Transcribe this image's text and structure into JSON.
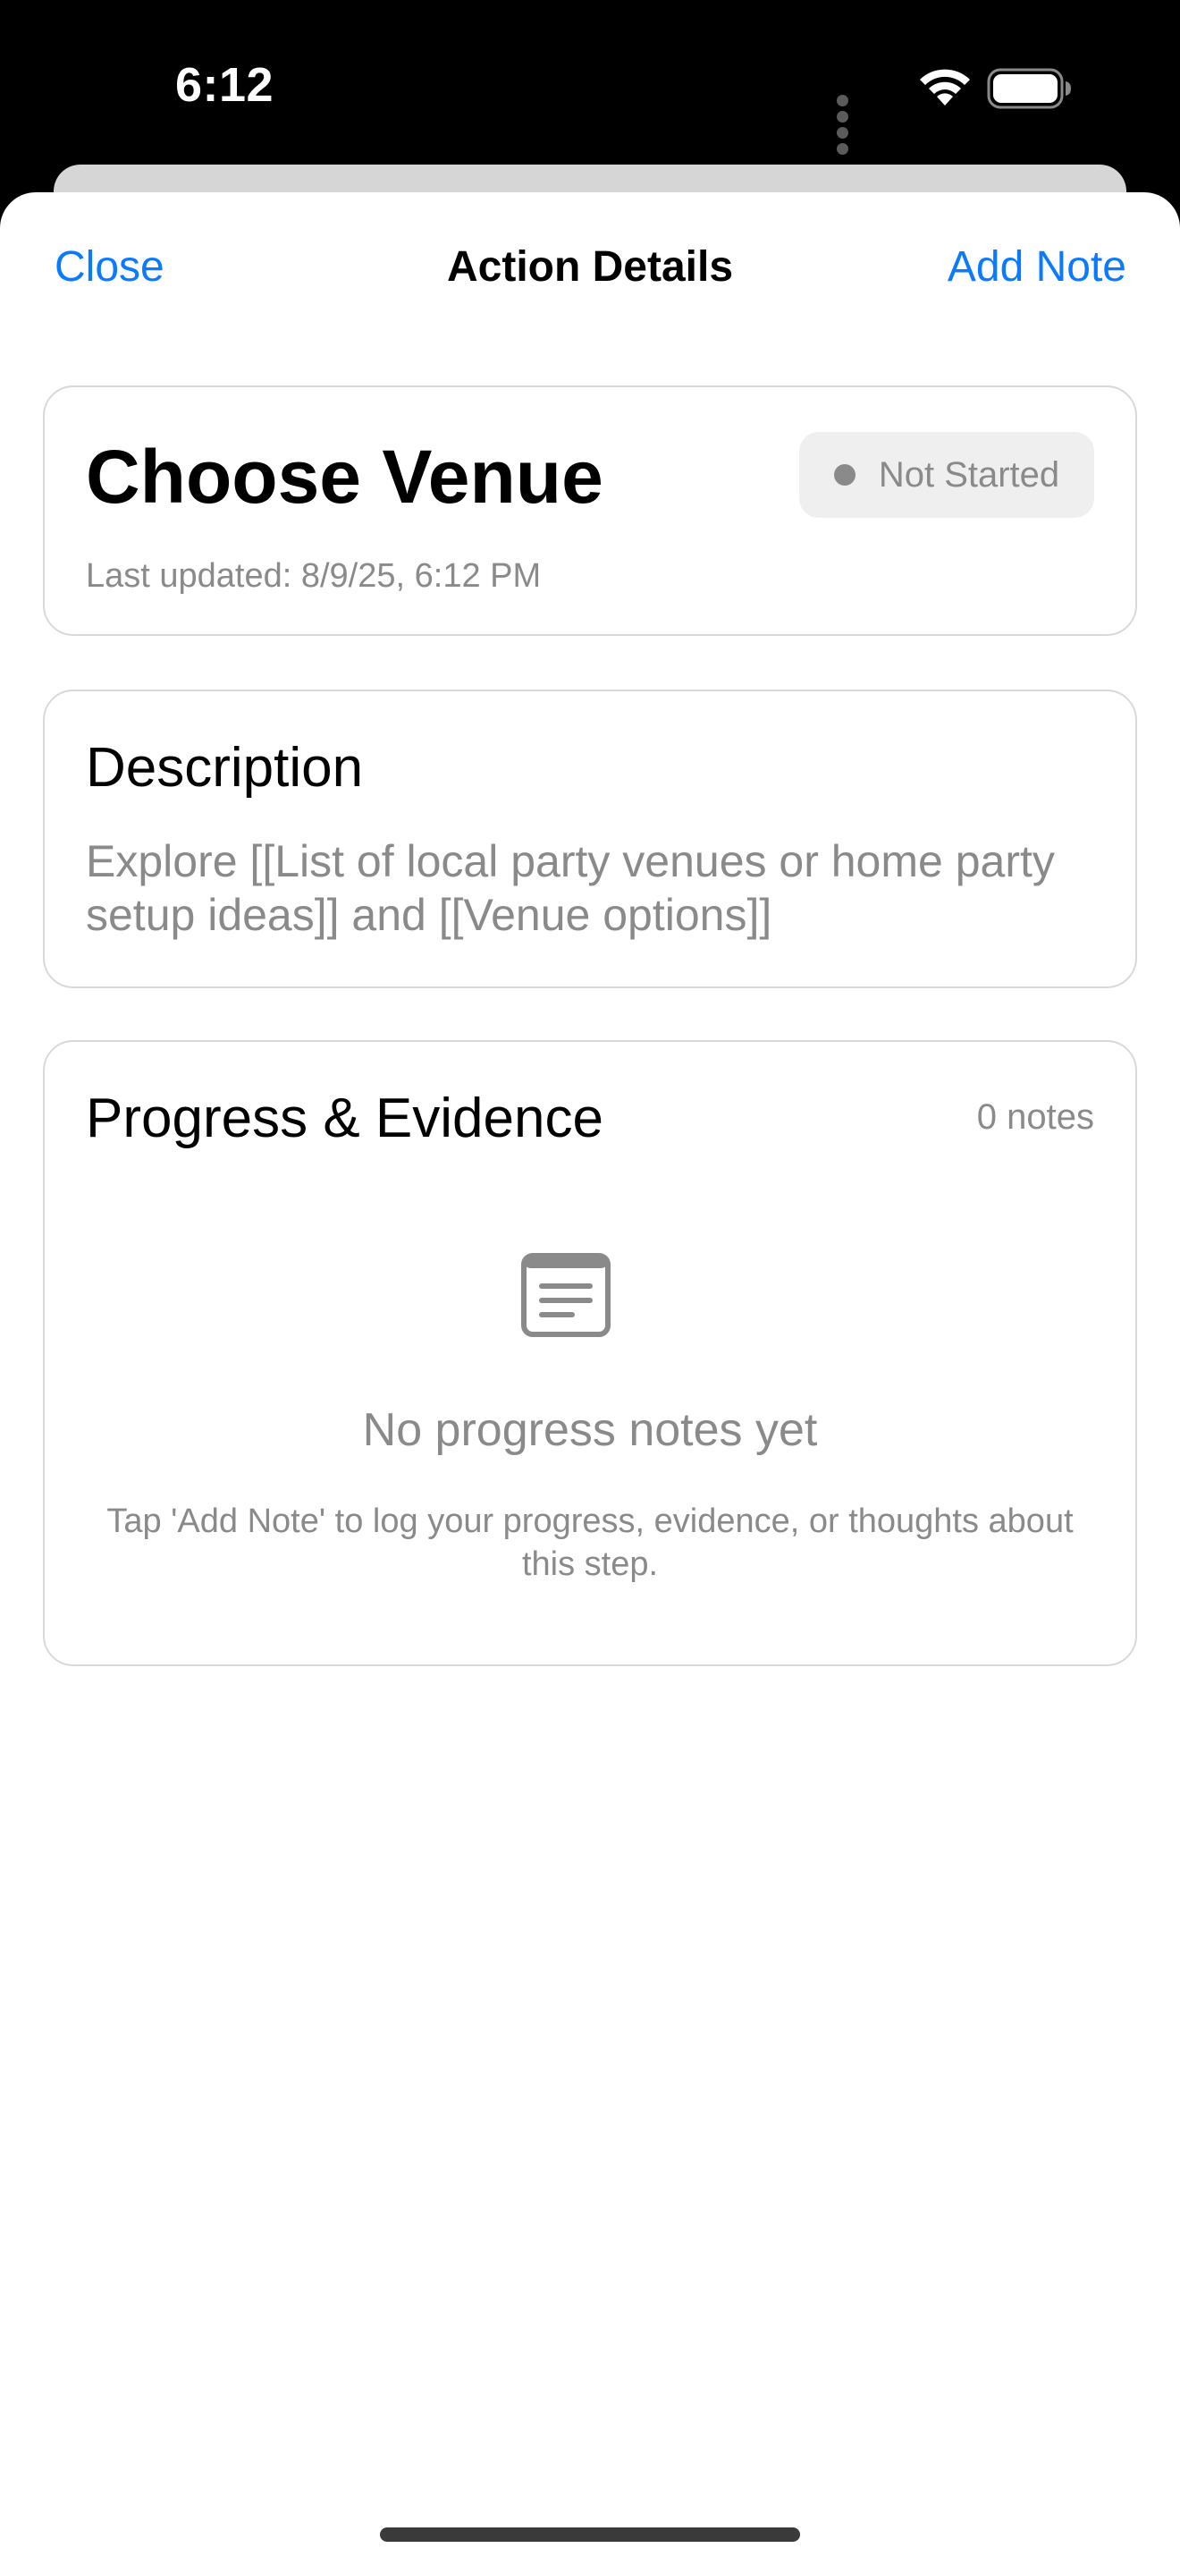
{
  "status_bar": {
    "time": "6:12",
    "icons": [
      "cellular-icon",
      "wifi-icon",
      "battery-icon"
    ]
  },
  "nav": {
    "close_label": "Close",
    "title": "Action Details",
    "add_note_label": "Add Note"
  },
  "action": {
    "title": "Choose Venue",
    "status": "Not Started",
    "last_updated": "Last updated: 8/9/25, 6:12 PM"
  },
  "description": {
    "heading": "Description",
    "text": "Explore [[List of local party venues or home party setup ideas]] and [[Venue options]]"
  },
  "progress": {
    "heading": "Progress & Evidence",
    "notes_count": "0 notes",
    "empty_title": "No progress notes yet",
    "empty_hint": "Tap 'Add Note' to log your progress, evidence, or thoughts about this step."
  },
  "colors": {
    "accent": "#0a7aff",
    "secondary_text": "#8a8a8a",
    "card_border": "#d9d9d9",
    "status_pill_bg": "#efefef"
  }
}
